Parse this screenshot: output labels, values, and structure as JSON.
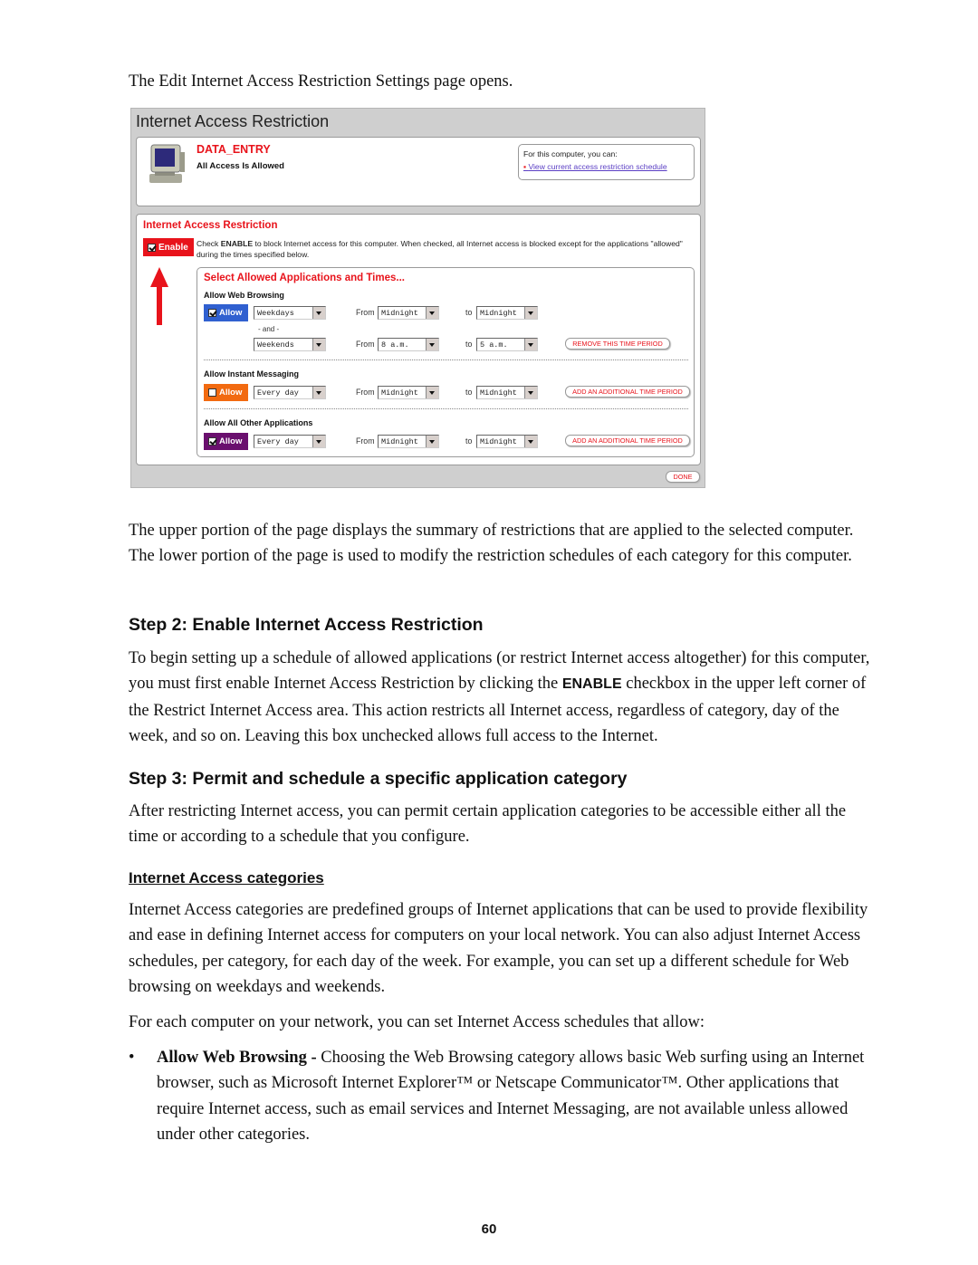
{
  "intro": "The Edit Internet Access Restriction Settings page opens.",
  "screenshot": {
    "window_title": "Internet Access Restriction",
    "computer": {
      "icon": "monitor-icon",
      "name": "DATA_ENTRY",
      "status": "All Access Is Allowed"
    },
    "info_box": {
      "heading": "For this computer, you can:",
      "link": "View current access restriction schedule"
    },
    "restriction": {
      "title": "Internet Access Restriction",
      "enable_label": "Enable",
      "enable_checked": true,
      "desc_prefix": "Check ",
      "desc_bold": "ENABLE",
      "desc_suffix": " to block Internet access for this computer. When checked, all Internet access is blocked except for the applications \"allowed\" during the times specified below."
    },
    "select_title": "Select Allowed Applications and Times...",
    "from_label": "From",
    "to_label": "to",
    "and_label": "- and -",
    "categories": [
      {
        "label": "Allow Web Browsing",
        "allow_label": "Allow",
        "checked": true,
        "color": "#3060d0",
        "periods": [
          {
            "days": "Weekdays",
            "from": "Midnight",
            "to": "Midnight"
          },
          {
            "days": "Weekends",
            "from": "8 a.m.",
            "to": "5 a.m.",
            "action": "REMOVE THIS TIME PERIOD"
          }
        ]
      },
      {
        "label": "Allow Instant Messaging",
        "allow_label": "Allow",
        "checked": false,
        "color": "#f26a10",
        "periods": [
          {
            "days": "Every day",
            "from": "Midnight",
            "to": "Midnight",
            "action": "ADD AN ADDITIONAL TIME PERIOD"
          }
        ]
      },
      {
        "label": "Allow All Other Applications",
        "allow_label": "Allow",
        "checked": true,
        "color": "#6a0f6e",
        "periods": [
          {
            "days": "Every day",
            "from": "Midnight",
            "to": "Midnight",
            "action": "ADD AN ADDITIONAL TIME PERIOD"
          }
        ]
      }
    ],
    "done_label": "DONE"
  },
  "para1": "The upper portion of the page displays the summary of restrictions that are applied to the selected computer. The lower portion of the page is used to modify the restriction schedules of each category for this computer.",
  "step2": {
    "heading": "Step 2: Enable Internet Access Restriction",
    "text_a": "To begin setting up a schedule of allowed applications (or restrict Internet access altogether) for this computer, you must first enable Internet Access Restriction by clicking the ",
    "text_bold": "ENABLE",
    "text_b": " checkbox in the upper left corner of the Restrict Internet Access area. This action restricts all Internet access, regardless of category, day of the week, and so on. Leaving this box unchecked allows full access to the Internet."
  },
  "step3": {
    "heading": "Step 3: Permit and schedule a specific application category",
    "text": "After restricting Internet access, you can permit certain application categories to be accessible either all the time or according to a schedule that you configure."
  },
  "categories_section": {
    "heading": "Internet Access categories",
    "text": "Internet Access categories are predefined groups of Internet applications that can be used to provide flexibility and ease in defining Internet access for computers on your local network. You can also adjust Internet Access schedules, per category, for each day of the week. For example, you can set up a different schedule for Web browsing on weekdays and weekends.",
    "text2": "For each computer on your network, you can set Internet Access schedules that allow:",
    "bullets": [
      {
        "bold": "Allow Web Browsing -",
        "text": " Choosing the Web Browsing category allows basic Web surfing using an Internet browser, such as Microsoft Internet Explorer™ or Netscape Communicator™. Other applications that require Internet access, such as email services and Internet Messaging, are not available unless allowed under other categories."
      }
    ]
  },
  "page_number": "60"
}
